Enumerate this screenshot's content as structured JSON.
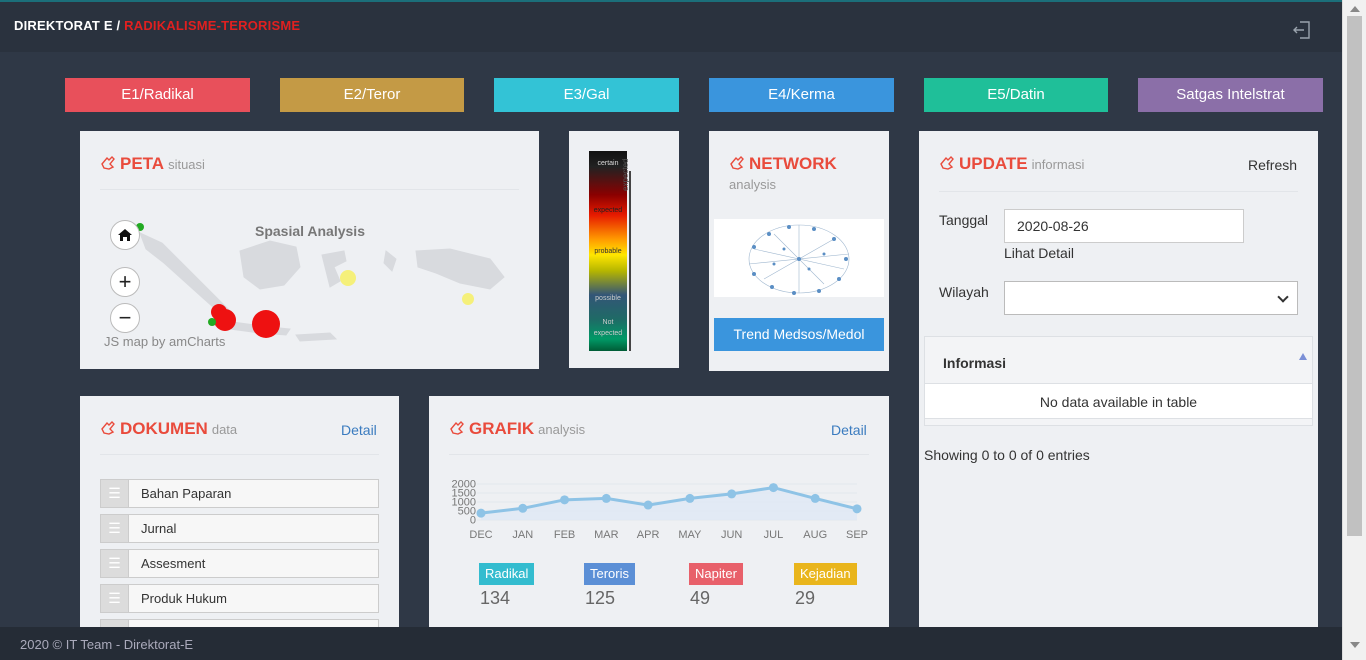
{
  "header": {
    "brand": "DIREKTORAT  E / ",
    "brand_sub": "RADIKALISME-TERORISME",
    "logout_icon": "logout-icon"
  },
  "nav": [
    {
      "label": "E1/Radikal",
      "color": "#e8505b"
    },
    {
      "label": "E2/Teror",
      "color": "#c49a45"
    },
    {
      "label": "E3/Gal",
      "color": "#33c3d6"
    },
    {
      "label": "E4/Kerma",
      "color": "#3a95dd"
    },
    {
      "label": "E5/Datin",
      "color": "#1fbf99"
    },
    {
      "label": "Satgas Intelstrat",
      "color": "#8b6fa8"
    }
  ],
  "peta": {
    "title": "PETA",
    "subtitle": "situasi",
    "map_title": "Spasial Analysis",
    "credit": "JS map by amCharts",
    "home_icon": "home-icon",
    "zoom_in": "+",
    "zoom_out": "−"
  },
  "legend_scale": {
    "labels": [
      "certain",
      "expected",
      "probable",
      "possible",
      "Not expected"
    ],
    "side_label": "expected"
  },
  "network": {
    "title": "NETWORK",
    "subtitle": "analysis",
    "button": "Trend Medsos/Medol"
  },
  "update": {
    "title": "UPDATE",
    "subtitle": "informasi",
    "refresh": "Refresh",
    "tanggal_label": "Tanggal",
    "tanggal_value": "2020-08-26",
    "lihat_detail": "Lihat Detail",
    "wilayah_label": "Wilayah",
    "wilayah_value": "",
    "table_header": "Informasi",
    "empty": "No data available in table",
    "showing": "Showing 0 to 0 of 0 entries"
  },
  "dokumen": {
    "title": "DOKUMEN",
    "subtitle": "data",
    "detail": "Detail",
    "items": [
      "Bahan Paparan",
      "Jurnal",
      "Assesment",
      "Produk Hukum"
    ]
  },
  "grafik": {
    "title": "GRAFIK",
    "subtitle": "analysis",
    "detail": "Detail",
    "stats": [
      {
        "label": "Radikal",
        "value": "134",
        "color": "#33bccf"
      },
      {
        "label": "Teroris",
        "value": "125",
        "color": "#5b8fd6"
      },
      {
        "label": "Napiter",
        "value": "49",
        "color": "#e8606a"
      },
      {
        "label": "Kejadian",
        "value": "29",
        "color": "#e9b51c"
      }
    ]
  },
  "chart_data": {
    "type": "line",
    "categories": [
      "DEC",
      "JAN",
      "FEB",
      "MAR",
      "APR",
      "MAY",
      "JUN",
      "JUL",
      "AUG",
      "SEP"
    ],
    "values": [
      380,
      650,
      1120,
      1200,
      830,
      1200,
      1450,
      1800,
      1200,
      620
    ],
    "y_ticks": [
      "2000",
      "1500",
      "1000",
      "500",
      "0"
    ],
    "ylim": [
      0,
      2000
    ],
    "line_color": "#8ec3e6",
    "grid": true
  },
  "footer": {
    "text": "2020 © IT Team - Direktorat-E"
  }
}
